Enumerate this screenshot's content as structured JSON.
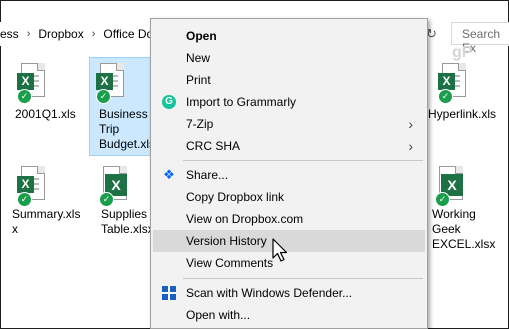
{
  "breadcrumb": {
    "items": [
      "ess",
      "Dropbox",
      "Office Do"
    ]
  },
  "search": {
    "placeholder": "Search Ex"
  },
  "files": [
    {
      "name": "2001Q1.xls"
    },
    {
      "name": "Business Trip Budget.xlsx"
    },
    {
      "name": "Summary.xls"
    },
    {
      "name": "Supplies Table.xlsx"
    },
    {
      "name": "Hyperlink.xls"
    },
    {
      "name": "Working Geek EXCEL.xlsx"
    }
  ],
  "file_labels": {
    "f1": "2001Q1.xls",
    "f2a": "Business",
    "f2b": "Trip",
    "f2c": "Budget.xlsx",
    "f3a": "Summary.xls",
    "f3b": "x",
    "f4a": "Supplies",
    "f4b": "Table.xlsx",
    "f5": "Hyperlink.xls",
    "f6a": "Working",
    "f6b": "Geek",
    "f6c": "EXCEL.xlsx"
  },
  "context_menu": {
    "open": "Open",
    "new": "New",
    "print": "Print",
    "grammarly": "Import to Grammarly",
    "sevenzip": "7-Zip",
    "crc": "CRC SHA",
    "share": "Share...",
    "copy_link": "Copy Dropbox link",
    "view_dropbox": "View on Dropbox.com",
    "version_history": "Version History",
    "view_comments": "View Comments",
    "defender": "Scan with Windows Defender...",
    "open_with": "Open with..."
  },
  "icons": {
    "excel": "excel-icon",
    "sync_check": "sync-check-icon",
    "grammarly": "grammarly-icon",
    "dropbox": "dropbox-icon",
    "defender": "windows-defender-icon",
    "submenu": "chevron-right-icon"
  },
  "colors": {
    "selection": "#cce8ff",
    "excel_green": "#1e7145",
    "menu_bg": "#f2f2f2",
    "hover": "#d9d9d9"
  }
}
